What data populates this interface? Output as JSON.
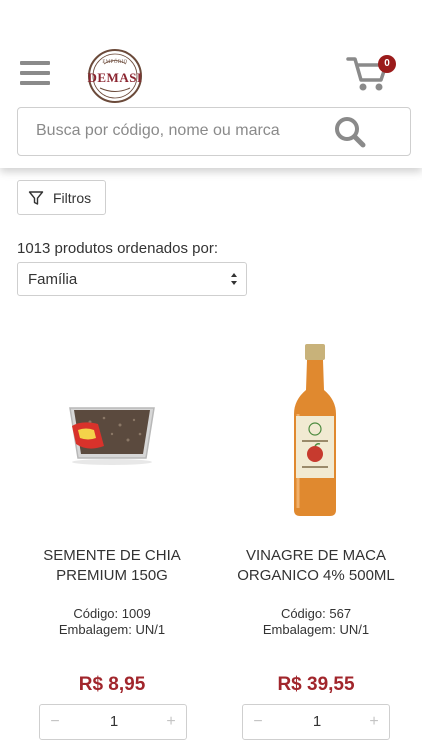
{
  "header": {
    "logo_name": "DEMASI",
    "logo_tagline": "EMPÓRIO",
    "cart_count": "0",
    "search_placeholder": "Busca por código, nome ou marca"
  },
  "toolbar": {
    "filter_label": "Filtros",
    "count_text": "1013 produtos ordenados por:",
    "sort_value": "Família"
  },
  "products": [
    {
      "name": "SEMENTE DE CHIA PREMIUM 150G",
      "code": "Código: 1009",
      "package": "Embalagem: UN/1",
      "price": "R$ 8,95",
      "quantity": "1",
      "minus": "−",
      "plus": "+"
    },
    {
      "name": "VINAGRE DE MACA ORGANICO 4% 500ML",
      "code": "Código: 567",
      "package": "Embalagem: UN/1",
      "price": "R$ 39,55",
      "quantity": "1",
      "minus": "−",
      "plus": "+"
    }
  ],
  "colors": {
    "accent": "#9b1b1b",
    "price": "#a1262c",
    "icon_gray": "#8a8a8a"
  },
  "icons": [
    "menu-icon",
    "cart-icon",
    "search-icon",
    "filter-icon",
    "sort-arrows-icon"
  ]
}
